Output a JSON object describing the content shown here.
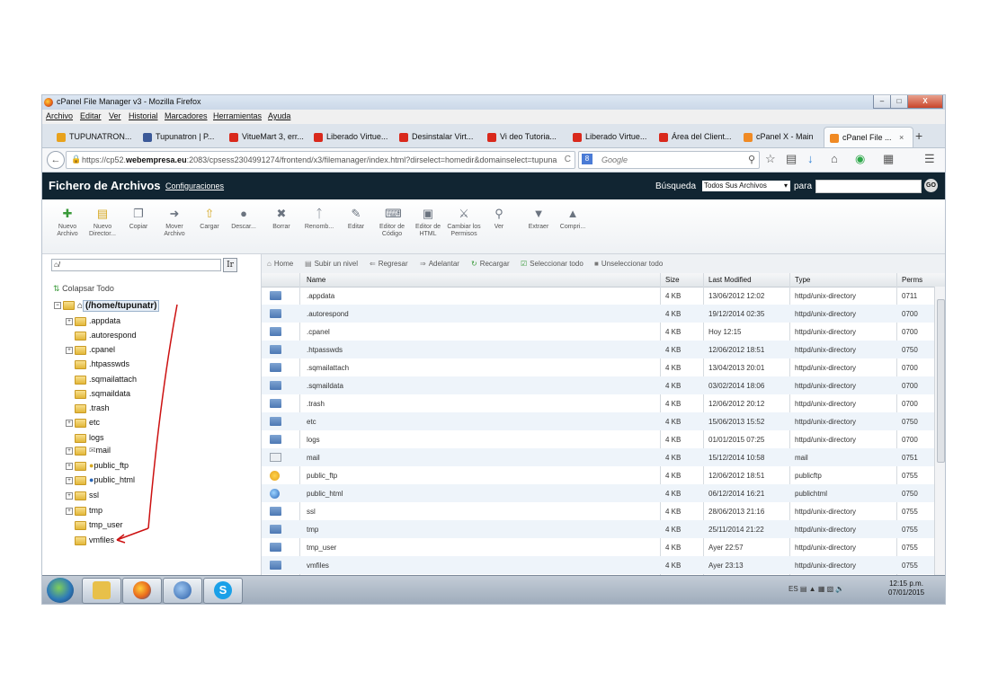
{
  "browser": {
    "title": "cPanel File Manager v3 - Mozilla Firefox",
    "window_controls": {
      "minimize": "–",
      "maximize": "□",
      "close": "X"
    },
    "menu": [
      "Archivo",
      "Editar",
      "Ver",
      "Historial",
      "Marcadores",
      "Herramientas",
      "Ayuda"
    ],
    "tabs": [
      {
        "label": "TUPUNATRON...",
        "color": "#e8a21c"
      },
      {
        "label": "Tupunatron | P...",
        "color": "#3b5998"
      },
      {
        "label": "VitueMart 3, err...",
        "color": "#d9291c"
      },
      {
        "label": "Liberado Virtue...",
        "color": "#d9291c"
      },
      {
        "label": "Desinstalar Virt...",
        "color": "#d9291c"
      },
      {
        "label": "Vi deo Tutoria...",
        "color": "#d9291c"
      },
      {
        "label": "Liberado Virtue...",
        "color": "#d9291c"
      },
      {
        "label": "Área del Client...",
        "color": "#d9291c"
      },
      {
        "label": "cPanel X - Main",
        "color": "#f08a24"
      },
      {
        "label": "cPanel File ...",
        "color": "#f08a24"
      }
    ],
    "tab_close": "×",
    "new_tab": "+",
    "url_prefix": "https://cp52.",
    "url_domain": "webempresa.eu",
    "url_rest": ":2083/cpsess2304991274/frontend/x3/filemanager/index.html?dirselect=homedir&domainselect=tupuna",
    "url_reload": "C",
    "search_engine": "8",
    "search_placeholder": "Google"
  },
  "cpanel": {
    "title": "Fichero de Archivos",
    "config_link": "Configuraciones",
    "search_label": "Búsqueda",
    "search_scope": "Todos Sus Archivos",
    "para_label": "para",
    "go_label": "GO"
  },
  "toolbar": [
    {
      "label": "Nuevo Archivo",
      "icon": "new-file-icon"
    },
    {
      "label": "Nuevo Director...",
      "icon": "new-folder-icon"
    },
    {
      "label": "Copiar",
      "icon": "copy-icon"
    },
    {
      "label": "Mover Archivo",
      "icon": "move-icon"
    },
    {
      "label": "Cargar",
      "icon": "upload-icon"
    },
    {
      "label": "Descar...",
      "icon": "download-icon"
    },
    {
      "label": "Borrar",
      "icon": "delete-icon"
    },
    {
      "label": "Renomb...",
      "icon": "rename-icon"
    },
    {
      "label": "Editar",
      "icon": "edit-icon"
    },
    {
      "label": "Editor de Código",
      "icon": "code-editor-icon"
    },
    {
      "label": "Editor de HTML",
      "icon": "html-editor-icon"
    },
    {
      "label": "Cambiar los Permisos",
      "icon": "permissions-icon"
    },
    {
      "label": "Ver",
      "icon": "view-icon"
    },
    {
      "label": "Extraer",
      "icon": "extract-icon"
    },
    {
      "label": "Compri...",
      "icon": "compress-icon"
    }
  ],
  "tree": {
    "path_value": "/",
    "go_button": "Ir",
    "collapse_label": "Colapsar Todo",
    "root": "(/home/tupunatr)",
    "items": [
      {
        "label": ".appdata",
        "expandable": true
      },
      {
        "label": ".autorespond",
        "expandable": false
      },
      {
        "label": ".cpanel",
        "expandable": true
      },
      {
        "label": ".htpasswds",
        "expandable": false
      },
      {
        "label": ".sqmailattach",
        "expandable": false
      },
      {
        "label": ".sqmaildata",
        "expandable": false
      },
      {
        "label": ".trash",
        "expandable": false
      },
      {
        "label": "etc",
        "expandable": true
      },
      {
        "label": "logs",
        "expandable": false
      },
      {
        "label": "mail",
        "expandable": true
      },
      {
        "label": "public_ftp",
        "expandable": true
      },
      {
        "label": "public_html",
        "expandable": true
      },
      {
        "label": "ssl",
        "expandable": true
      },
      {
        "label": "tmp",
        "expandable": true
      },
      {
        "label": "tmp_user",
        "expandable": false
      },
      {
        "label": "vmfiles",
        "expandable": false
      }
    ]
  },
  "navrow": [
    "Home",
    "Subir un nivel",
    "Regresar",
    "Adelantar",
    "Recargar",
    "Seleccionar todo",
    "Unseleccionar todo"
  ],
  "table": {
    "columns": [
      "Name",
      "Size",
      "Last Modified",
      "Type",
      "Perms"
    ],
    "rows": [
      {
        "icon": "dir",
        "name": ".appdata",
        "size": "4 KB",
        "modified": "13/06/2012 12:02",
        "type": "httpd/unix-directory",
        "perms": "0711"
      },
      {
        "icon": "dir",
        "name": ".autorespond",
        "size": "4 KB",
        "modified": "19/12/2014 02:35",
        "type": "httpd/unix-directory",
        "perms": "0700"
      },
      {
        "icon": "dir",
        "name": ".cpanel",
        "size": "4 KB",
        "modified": "Hoy 12:15",
        "type": "httpd/unix-directory",
        "perms": "0700"
      },
      {
        "icon": "dir",
        "name": ".htpasswds",
        "size": "4 KB",
        "modified": "12/06/2012 18:51",
        "type": "httpd/unix-directory",
        "perms": "0750"
      },
      {
        "icon": "dir",
        "name": ".sqmailattach",
        "size": "4 KB",
        "modified": "13/04/2013 20:01",
        "type": "httpd/unix-directory",
        "perms": "0700"
      },
      {
        "icon": "dir",
        "name": ".sqmaildata",
        "size": "4 KB",
        "modified": "03/02/2014 18:06",
        "type": "httpd/unix-directory",
        "perms": "0700"
      },
      {
        "icon": "dir",
        "name": ".trash",
        "size": "4 KB",
        "modified": "12/06/2012 20:12",
        "type": "httpd/unix-directory",
        "perms": "0700"
      },
      {
        "icon": "dir",
        "name": "etc",
        "size": "4 KB",
        "modified": "15/06/2013 15:52",
        "type": "httpd/unix-directory",
        "perms": "0750"
      },
      {
        "icon": "dir",
        "name": "logs",
        "size": "4 KB",
        "modified": "01/01/2015 07:25",
        "type": "httpd/unix-directory",
        "perms": "0700"
      },
      {
        "icon": "mailic",
        "name": "mail",
        "size": "4 KB",
        "modified": "15/12/2014 10:58",
        "type": "mail",
        "perms": "0751"
      },
      {
        "icon": "ftpic",
        "name": "public_ftp",
        "size": "4 KB",
        "modified": "12/06/2012 18:51",
        "type": "publicftp",
        "perms": "0755"
      },
      {
        "icon": "globe",
        "name": "public_html",
        "size": "4 KB",
        "modified": "06/12/2014 16:21",
        "type": "publichtml",
        "perms": "0750"
      },
      {
        "icon": "dir",
        "name": "ssl",
        "size": "4 KB",
        "modified": "28/06/2013 21:16",
        "type": "httpd/unix-directory",
        "perms": "0755"
      },
      {
        "icon": "dir",
        "name": "tmp",
        "size": "4 KB",
        "modified": "25/11/2014 21:22",
        "type": "httpd/unix-directory",
        "perms": "0755"
      },
      {
        "icon": "dir",
        "name": "tmp_user",
        "size": "4 KB",
        "modified": "Ayer 22:57",
        "type": "httpd/unix-directory",
        "perms": "0755"
      },
      {
        "icon": "dir",
        "name": "vmfiles",
        "size": "4 KB",
        "modified": "Ayer 23:13",
        "type": "httpd/unix-directory",
        "perms": "0755"
      }
    ]
  },
  "taskbar": {
    "language": "ES",
    "time": "12:15 p.m.",
    "date": "07/01/2015",
    "apps": [
      {
        "name": "explorer",
        "color": "#e8c04a"
      },
      {
        "name": "firefox",
        "color": "#e8681c"
      },
      {
        "name": "thunderbird",
        "color": "#2b5fa8"
      },
      {
        "name": "skype",
        "color": "#1aa0e8"
      }
    ]
  },
  "annotation_color": "#cc1111"
}
